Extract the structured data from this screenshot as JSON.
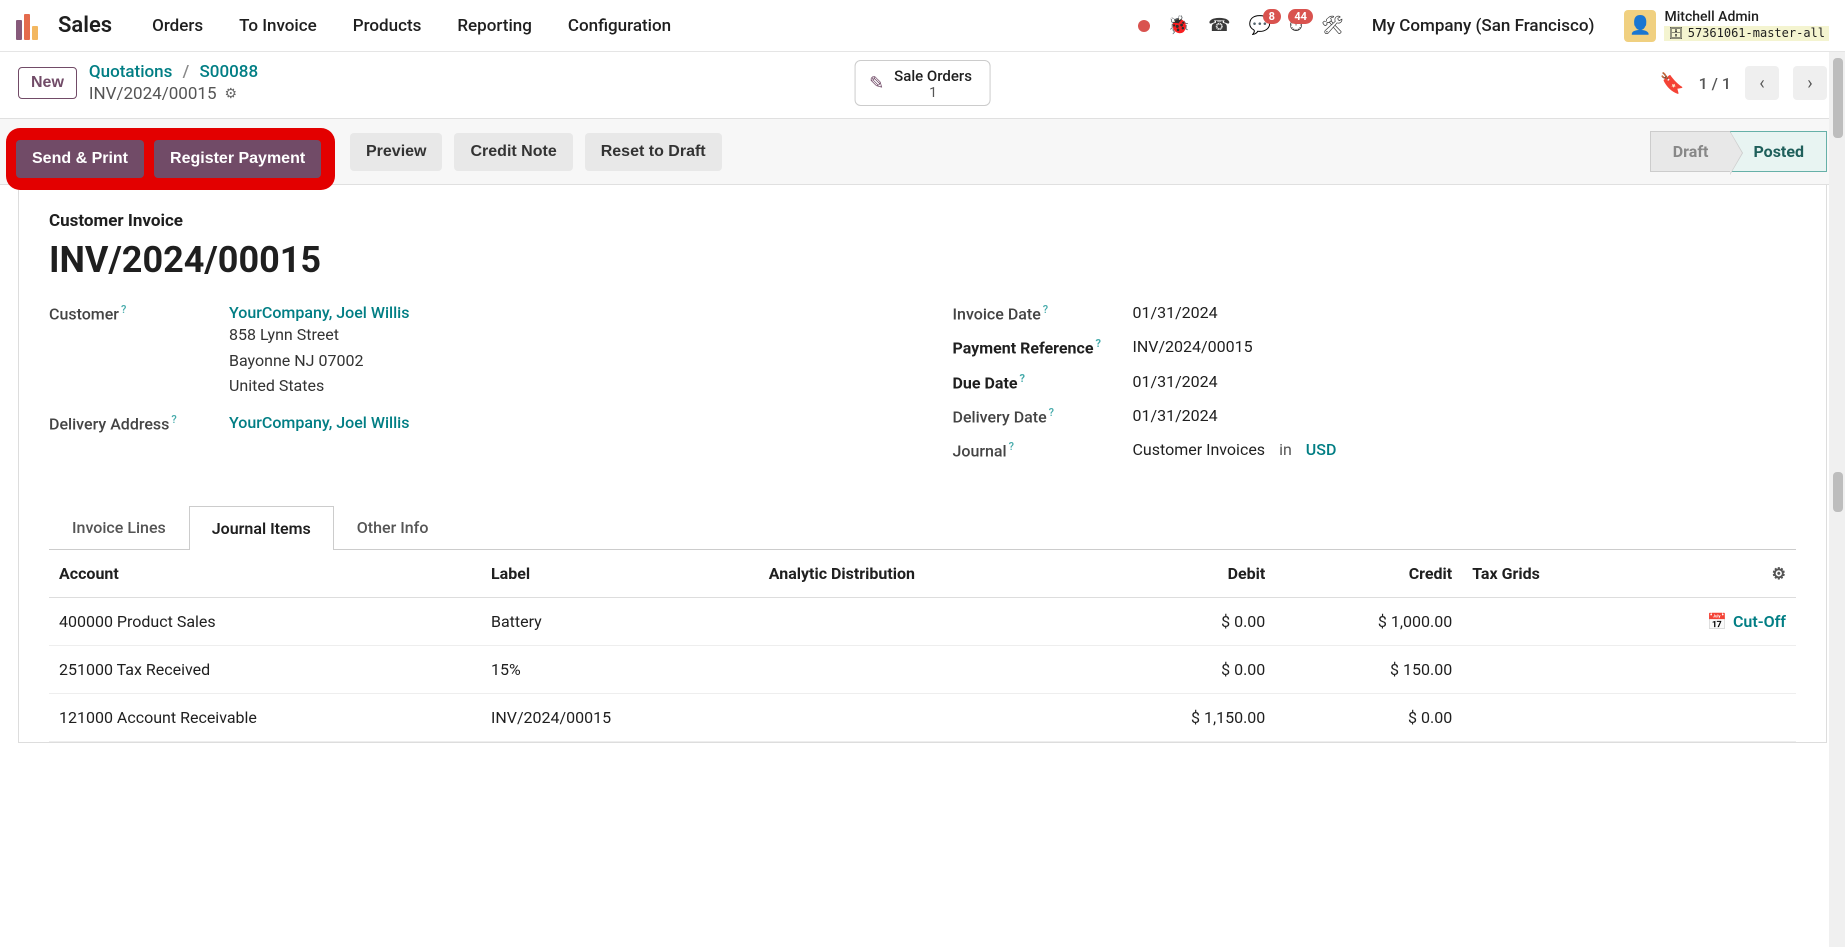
{
  "topnav": {
    "app_title": "Sales",
    "items": [
      "Orders",
      "To Invoice",
      "Products",
      "Reporting",
      "Configuration"
    ],
    "company": "My Company (San Francisco)",
    "badges": {
      "chat": "8",
      "clock": "44"
    },
    "user": {
      "name": "Mitchell Admin",
      "db": "57361061-master-all"
    }
  },
  "cp": {
    "new_label": "New",
    "breadcrumb": {
      "root": "Quotations",
      "so": "S00088",
      "current": "INV/2024/00015"
    },
    "stat": {
      "label": "Sale Orders",
      "value": "1"
    },
    "pager": "1 / 1"
  },
  "actions": {
    "send_print": "Send & Print",
    "register_payment": "Register Payment",
    "preview": "Preview",
    "credit_note": "Credit Note",
    "reset_draft": "Reset to Draft",
    "status_draft": "Draft",
    "status_posted": "Posted"
  },
  "sheet": {
    "doc_type": "Customer Invoice",
    "doc_title": "INV/2024/00015",
    "labels": {
      "customer": "Customer",
      "delivery_address": "Delivery Address",
      "invoice_date": "Invoice Date",
      "payment_reference": "Payment Reference",
      "due_date": "Due Date",
      "delivery_date": "Delivery Date",
      "journal": "Journal",
      "in": "in"
    },
    "customer_link": "YourCompany, Joel Willis",
    "address": {
      "street": "858 Lynn Street",
      "city": "Bayonne NJ 07002",
      "country": "United States"
    },
    "delivery_link": "YourCompany, Joel Willis",
    "invoice_date": "01/31/2024",
    "payment_reference": "INV/2024/00015",
    "due_date": "01/31/2024",
    "delivery_date": "01/31/2024",
    "journal": "Customer Invoices",
    "currency": "USD"
  },
  "tabs": {
    "invoice_lines": "Invoice Lines",
    "journal_items": "Journal Items",
    "other_info": "Other Info"
  },
  "table": {
    "headers": {
      "account": "Account",
      "label": "Label",
      "analytic": "Analytic Distribution",
      "debit": "Debit",
      "credit": "Credit",
      "tax_grids": "Tax Grids"
    },
    "cutoff": "Cut-Off",
    "rows": [
      {
        "account": "400000 Product Sales",
        "label": "Battery",
        "debit": "$ 0.00",
        "credit": "$ 1,000.00",
        "cutoff": true
      },
      {
        "account": "251000 Tax Received",
        "label": "15%",
        "debit": "$ 0.00",
        "credit": "$ 150.00",
        "cutoff": false
      },
      {
        "account": "121000 Account Receivable",
        "label": "INV/2024/00015",
        "debit": "$ 1,150.00",
        "credit": "$ 0.00",
        "cutoff": false
      }
    ]
  }
}
